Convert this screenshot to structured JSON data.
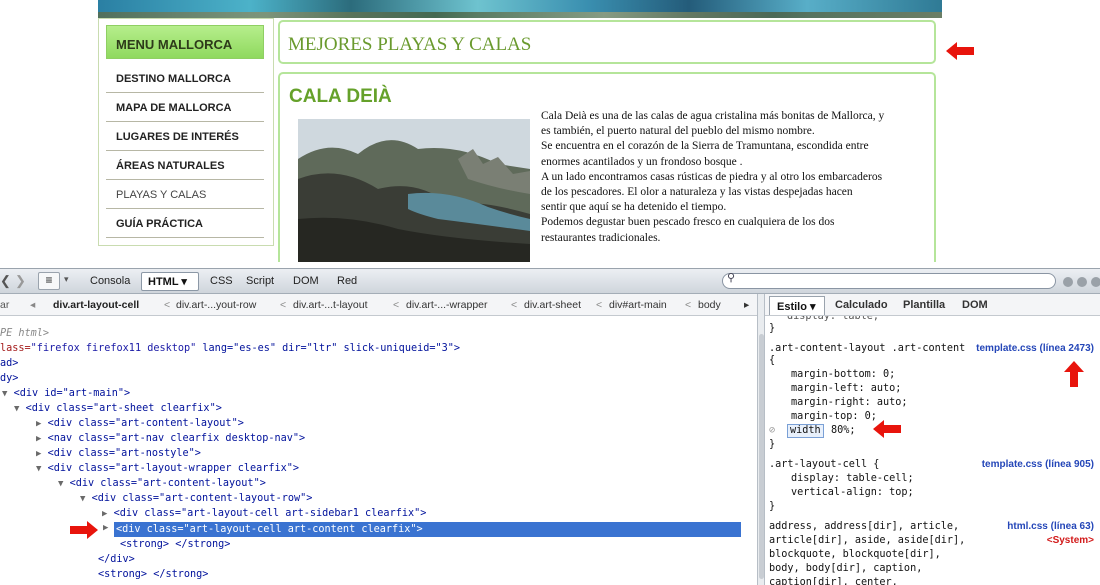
{
  "site": {
    "menu_title": "MENU MALLORCA",
    "menu_items": [
      "DESTINO MALLORCA",
      "MAPA DE MALLORCA",
      "LUGARES DE INTERÉS",
      "ÁREAS NATURALES",
      "PLAYAS Y CALAS",
      "GUÍA PRÁCTICA"
    ],
    "page_title": "MEJORES PLAYAS Y CALAS",
    "article_title": "CALA DEIÀ",
    "article_lines": [
      "Cala Deià es una de las calas de agua cristalina más bonitas de Mallorca, y",
      "es también, el puerto natural del pueblo del mismo nombre.",
      "Se encuentra en el corazón de la Sierra de Tramuntana, escondida entre",
      "enormes acantilados y un frondoso bosque .",
      "A un lado encontramos casas rústicas de piedra y al otro los embarcaderos",
      "de los pescadores. El olor a naturaleza y las vistas despejadas hacen",
      "sentir que aquí se ha detenido el tiempo.",
      "Podemos degustar buen pescado fresco en cualquiera de los dos",
      "restaurantes tradicionales."
    ],
    "accent_green": "#6a9a2e",
    "box_border": "#b5e59a"
  },
  "firebug": {
    "toolbar": {
      "tab_consola": "Consola",
      "tab_html": "HTML ▾",
      "tab_css": "CSS",
      "tab_script": "Script",
      "tab_dom": "DOM",
      "tab_red": "Red"
    },
    "breadcrumb": [
      "div.art-layout-cell",
      "div.art-...yout-row",
      "div.art-...t-layout",
      "div.art-...-wrapper",
      "div.art-sheet",
      "div#art-main",
      "body"
    ],
    "breadcrumb_left": "ar",
    "side_tabs": [
      "Estilo ▾",
      "Calculado",
      "Plantilla",
      "DOM"
    ],
    "tree": [
      {
        "indent": 0,
        "text": "PE html>"
      },
      {
        "indent": 0,
        "pre": "lass=",
        "val": "\"firefox firefox11 desktop\"",
        "rest": " lang=\"es-es\" dir=\"ltr\" slick-uniqueid=\"3\">"
      },
      {
        "indent": 0,
        "text": "ad>"
      },
      {
        "indent": 0,
        "text": "dy>"
      },
      {
        "indent": 1,
        "text": "<div id=\"art-main\">"
      },
      {
        "indent": 2,
        "text": "<div class=\"art-sheet clearfix\">"
      },
      {
        "indent": 3,
        "text": "<div class=\"art-content-layout\">"
      },
      {
        "indent": 3,
        "text": "<nav class=\"art-nav clearfix desktop-nav\">"
      },
      {
        "indent": 3,
        "text": "<div class=\"art-nostyle\">"
      },
      {
        "indent": 3,
        "text": "<div class=\"art-layout-wrapper clearfix\">"
      },
      {
        "indent": 4,
        "text": "<div class=\"art-content-layout\">"
      },
      {
        "indent": 5,
        "text": "<div class=\"art-content-layout-row\">"
      },
      {
        "indent": 6,
        "text": "<div class=\"art-layout-cell art-sidebar1 clearfix\">"
      },
      {
        "indent": 6,
        "text": "<div class=\"art-layout-cell art-content clearfix\">"
      },
      {
        "indent": 6,
        "text": "<strong> </strong>"
      },
      {
        "indent": 5,
        "text": "</div>"
      },
      {
        "indent": 5,
        "text": "<strong> </strong>"
      }
    ],
    "css_rules": {
      "line0": "display: table;",
      "close0": "}",
      "rule1_selector": ".art-content-layout .art-content",
      "rule1_source": "template.css (línea 2473)",
      "rule1_open": "{",
      "rule1_props": [
        "margin-bottom: 0;",
        "margin-left: auto;",
        "margin-right: auto;",
        "margin-top: 0;"
      ],
      "rule1_width_name": "width",
      "rule1_width_value": "80%;",
      "rule1_close": "}",
      "rule2_selector": ".art-layout-cell {",
      "rule2_source": "template.css (línea 905)",
      "rule2_props": [
        "display: table-cell;",
        "vertical-align: top;"
      ],
      "rule2_close": "}",
      "rule3_lines": [
        "address, address[dir], article,",
        "article[dir], aside, aside[dir],",
        "blockquote, blockquote[dir],",
        "body, body[dir], caption,",
        "caption[dir], center,"
      ],
      "rule3_source": "html.css (línea 63)",
      "rule3_system": "<System>"
    }
  }
}
